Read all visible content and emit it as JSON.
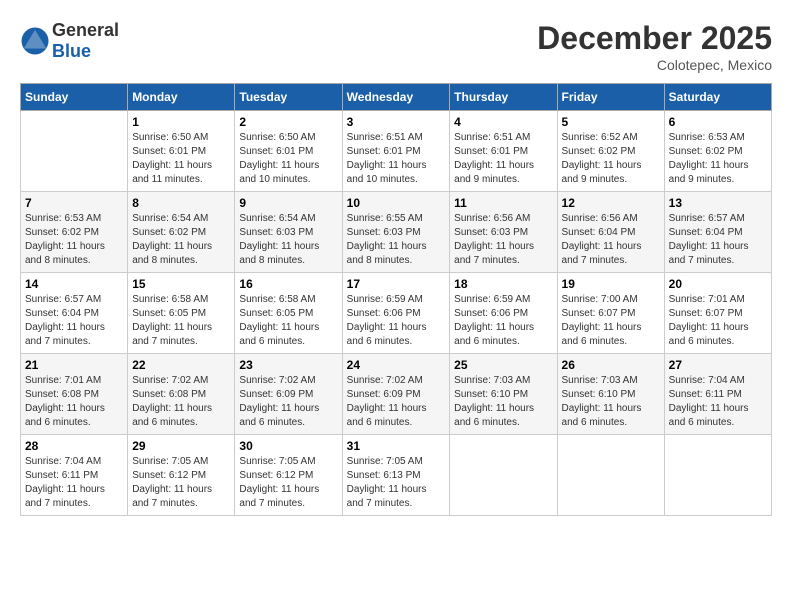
{
  "header": {
    "logo_general": "General",
    "logo_blue": "Blue",
    "month_title": "December 2025",
    "location": "Colotepec, Mexico"
  },
  "calendar": {
    "days_of_week": [
      "Sunday",
      "Monday",
      "Tuesday",
      "Wednesday",
      "Thursday",
      "Friday",
      "Saturday"
    ],
    "weeks": [
      [
        {
          "day": "",
          "sunrise": "",
          "sunset": "",
          "daylight": ""
        },
        {
          "day": "1",
          "sunrise": "Sunrise: 6:50 AM",
          "sunset": "Sunset: 6:01 PM",
          "daylight": "Daylight: 11 hours and 11 minutes."
        },
        {
          "day": "2",
          "sunrise": "Sunrise: 6:50 AM",
          "sunset": "Sunset: 6:01 PM",
          "daylight": "Daylight: 11 hours and 10 minutes."
        },
        {
          "day": "3",
          "sunrise": "Sunrise: 6:51 AM",
          "sunset": "Sunset: 6:01 PM",
          "daylight": "Daylight: 11 hours and 10 minutes."
        },
        {
          "day": "4",
          "sunrise": "Sunrise: 6:51 AM",
          "sunset": "Sunset: 6:01 PM",
          "daylight": "Daylight: 11 hours and 9 minutes."
        },
        {
          "day": "5",
          "sunrise": "Sunrise: 6:52 AM",
          "sunset": "Sunset: 6:02 PM",
          "daylight": "Daylight: 11 hours and 9 minutes."
        },
        {
          "day": "6",
          "sunrise": "Sunrise: 6:53 AM",
          "sunset": "Sunset: 6:02 PM",
          "daylight": "Daylight: 11 hours and 9 minutes."
        }
      ],
      [
        {
          "day": "7",
          "sunrise": "Sunrise: 6:53 AM",
          "sunset": "Sunset: 6:02 PM",
          "daylight": "Daylight: 11 hours and 8 minutes."
        },
        {
          "day": "8",
          "sunrise": "Sunrise: 6:54 AM",
          "sunset": "Sunset: 6:02 PM",
          "daylight": "Daylight: 11 hours and 8 minutes."
        },
        {
          "day": "9",
          "sunrise": "Sunrise: 6:54 AM",
          "sunset": "Sunset: 6:03 PM",
          "daylight": "Daylight: 11 hours and 8 minutes."
        },
        {
          "day": "10",
          "sunrise": "Sunrise: 6:55 AM",
          "sunset": "Sunset: 6:03 PM",
          "daylight": "Daylight: 11 hours and 8 minutes."
        },
        {
          "day": "11",
          "sunrise": "Sunrise: 6:56 AM",
          "sunset": "Sunset: 6:03 PM",
          "daylight": "Daylight: 11 hours and 7 minutes."
        },
        {
          "day": "12",
          "sunrise": "Sunrise: 6:56 AM",
          "sunset": "Sunset: 6:04 PM",
          "daylight": "Daylight: 11 hours and 7 minutes."
        },
        {
          "day": "13",
          "sunrise": "Sunrise: 6:57 AM",
          "sunset": "Sunset: 6:04 PM",
          "daylight": "Daylight: 11 hours and 7 minutes."
        }
      ],
      [
        {
          "day": "14",
          "sunrise": "Sunrise: 6:57 AM",
          "sunset": "Sunset: 6:04 PM",
          "daylight": "Daylight: 11 hours and 7 minutes."
        },
        {
          "day": "15",
          "sunrise": "Sunrise: 6:58 AM",
          "sunset": "Sunset: 6:05 PM",
          "daylight": "Daylight: 11 hours and 7 minutes."
        },
        {
          "day": "16",
          "sunrise": "Sunrise: 6:58 AM",
          "sunset": "Sunset: 6:05 PM",
          "daylight": "Daylight: 11 hours and 6 minutes."
        },
        {
          "day": "17",
          "sunrise": "Sunrise: 6:59 AM",
          "sunset": "Sunset: 6:06 PM",
          "daylight": "Daylight: 11 hours and 6 minutes."
        },
        {
          "day": "18",
          "sunrise": "Sunrise: 6:59 AM",
          "sunset": "Sunset: 6:06 PM",
          "daylight": "Daylight: 11 hours and 6 minutes."
        },
        {
          "day": "19",
          "sunrise": "Sunrise: 7:00 AM",
          "sunset": "Sunset: 6:07 PM",
          "daylight": "Daylight: 11 hours and 6 minutes."
        },
        {
          "day": "20",
          "sunrise": "Sunrise: 7:01 AM",
          "sunset": "Sunset: 6:07 PM",
          "daylight": "Daylight: 11 hours and 6 minutes."
        }
      ],
      [
        {
          "day": "21",
          "sunrise": "Sunrise: 7:01 AM",
          "sunset": "Sunset: 6:08 PM",
          "daylight": "Daylight: 11 hours and 6 minutes."
        },
        {
          "day": "22",
          "sunrise": "Sunrise: 7:02 AM",
          "sunset": "Sunset: 6:08 PM",
          "daylight": "Daylight: 11 hours and 6 minutes."
        },
        {
          "day": "23",
          "sunrise": "Sunrise: 7:02 AM",
          "sunset": "Sunset: 6:09 PM",
          "daylight": "Daylight: 11 hours and 6 minutes."
        },
        {
          "day": "24",
          "sunrise": "Sunrise: 7:02 AM",
          "sunset": "Sunset: 6:09 PM",
          "daylight": "Daylight: 11 hours and 6 minutes."
        },
        {
          "day": "25",
          "sunrise": "Sunrise: 7:03 AM",
          "sunset": "Sunset: 6:10 PM",
          "daylight": "Daylight: 11 hours and 6 minutes."
        },
        {
          "day": "26",
          "sunrise": "Sunrise: 7:03 AM",
          "sunset": "Sunset: 6:10 PM",
          "daylight": "Daylight: 11 hours and 6 minutes."
        },
        {
          "day": "27",
          "sunrise": "Sunrise: 7:04 AM",
          "sunset": "Sunset: 6:11 PM",
          "daylight": "Daylight: 11 hours and 6 minutes."
        }
      ],
      [
        {
          "day": "28",
          "sunrise": "Sunrise: 7:04 AM",
          "sunset": "Sunset: 6:11 PM",
          "daylight": "Daylight: 11 hours and 7 minutes."
        },
        {
          "day": "29",
          "sunrise": "Sunrise: 7:05 AM",
          "sunset": "Sunset: 6:12 PM",
          "daylight": "Daylight: 11 hours and 7 minutes."
        },
        {
          "day": "30",
          "sunrise": "Sunrise: 7:05 AM",
          "sunset": "Sunset: 6:12 PM",
          "daylight": "Daylight: 11 hours and 7 minutes."
        },
        {
          "day": "31",
          "sunrise": "Sunrise: 7:05 AM",
          "sunset": "Sunset: 6:13 PM",
          "daylight": "Daylight: 11 hours and 7 minutes."
        },
        {
          "day": "",
          "sunrise": "",
          "sunset": "",
          "daylight": ""
        },
        {
          "day": "",
          "sunrise": "",
          "sunset": "",
          "daylight": ""
        },
        {
          "day": "",
          "sunrise": "",
          "sunset": "",
          "daylight": ""
        }
      ]
    ]
  }
}
